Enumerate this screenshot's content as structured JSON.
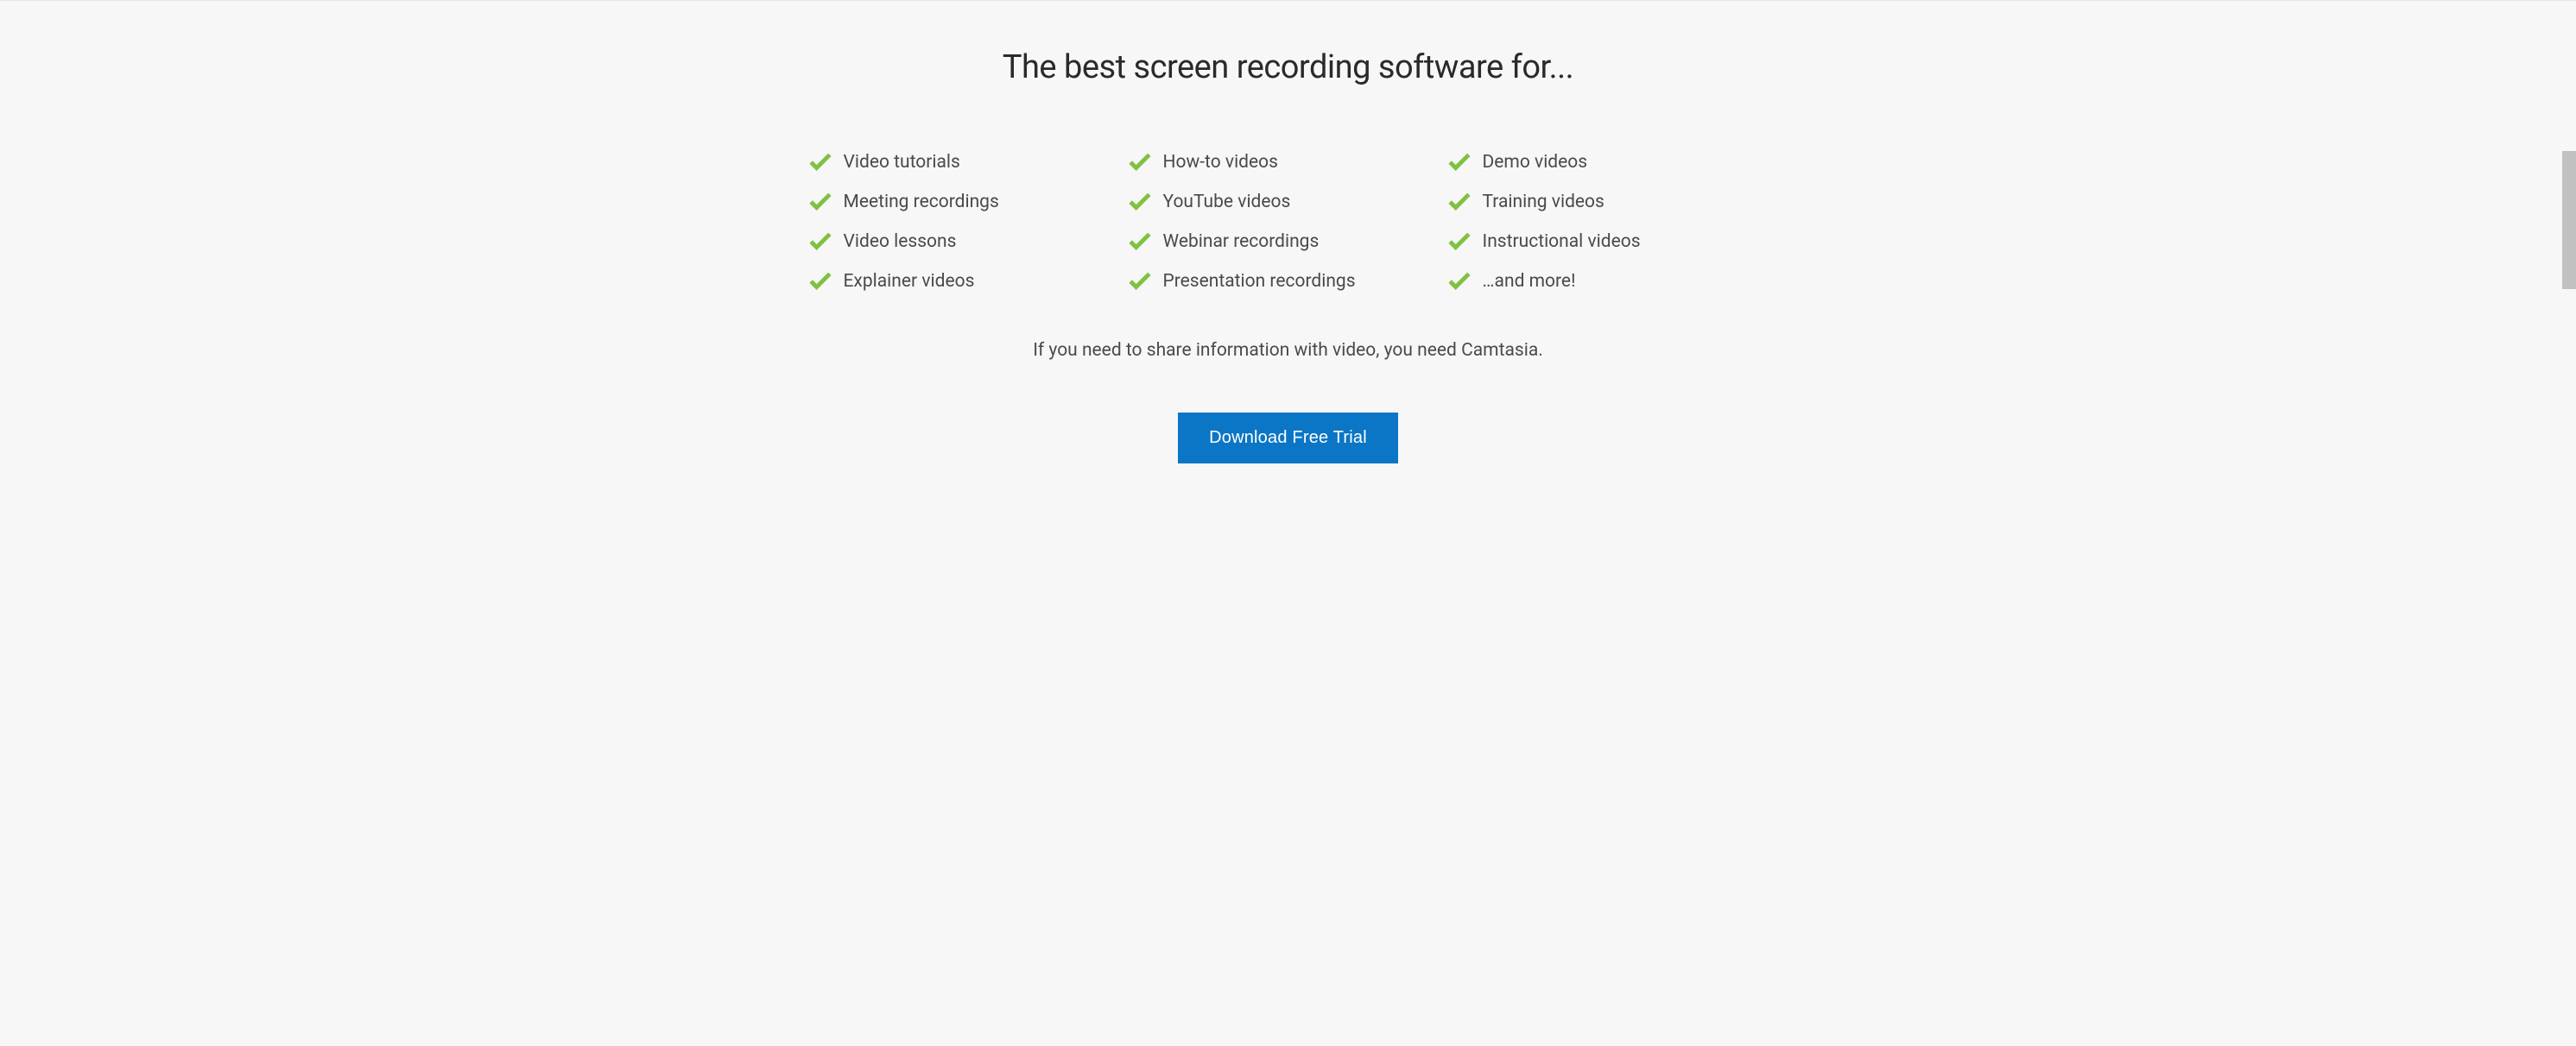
{
  "heading": "The best screen recording software for...",
  "columns": [
    {
      "items": [
        "Video tutorials",
        "Meeting recordings",
        "Video lessons",
        "Explainer videos"
      ]
    },
    {
      "items": [
        "How-to videos",
        "YouTube videos",
        "Webinar recordings",
        "Presentation recordings"
      ]
    },
    {
      "items": [
        "Demo videos",
        "Training videos",
        "Instructional videos",
        "…and more!"
      ]
    }
  ],
  "tagline": "If you need to share information with video, you need Camtasia.",
  "cta_label": "Download Free Trial",
  "colors": {
    "check": "#7fc241",
    "button": "#0b76c5"
  }
}
